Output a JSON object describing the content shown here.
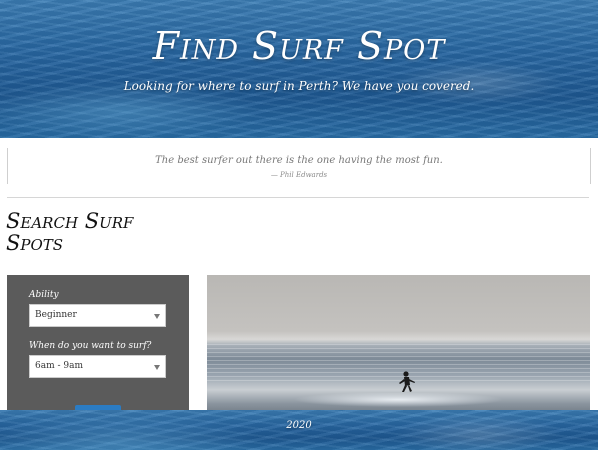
{
  "hero": {
    "title": "Find Surf Spot",
    "subtitle": "Looking for where to surf in Perth? We have you covered."
  },
  "quote": {
    "text": "The best surfer out there is the one having the most fun.",
    "author": "— Phil Edwards"
  },
  "search": {
    "section_title_line1": "Search Surf",
    "section_title_line2": "Spots",
    "ability_label": "Ability",
    "ability_value": "Beginner",
    "time_label": "When do you want to surf?",
    "time_value": "6am - 9am"
  },
  "footer": {
    "text": "2020"
  },
  "colors": {
    "panel": "#5b5b5b",
    "button": "#2b7cc4",
    "ocean": "#2a6aa5"
  }
}
